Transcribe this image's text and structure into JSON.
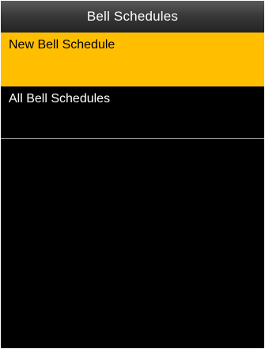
{
  "window": {
    "title": "Bell Schedules"
  },
  "menu": {
    "items": [
      {
        "label": "New Bell Schedule",
        "selected": true
      },
      {
        "label": "All Bell Schedules",
        "selected": false
      }
    ]
  },
  "colors": {
    "highlight": "#FFBF00",
    "background": "#000000",
    "titlebar": "#3A3A3A",
    "divider": "#9A9A9A"
  }
}
